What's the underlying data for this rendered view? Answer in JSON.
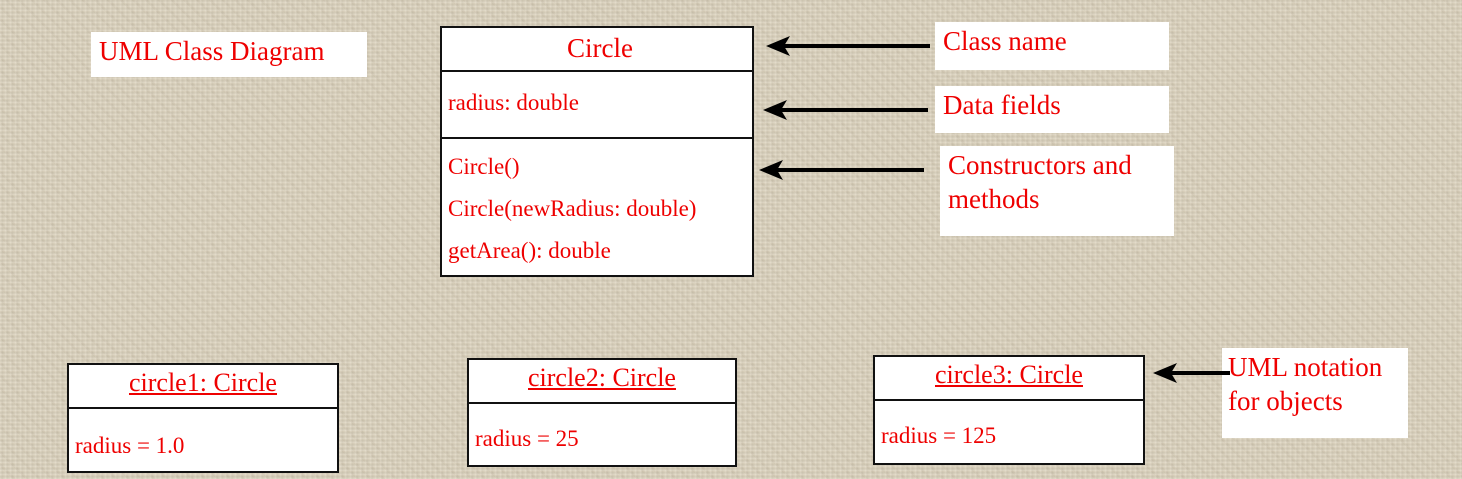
{
  "diagram_title": "UML Class Diagram",
  "class_box": {
    "name": "Circle",
    "fields": [
      "radius: double"
    ],
    "methods": [
      "Circle()",
      "Circle(newRadius: double)",
      "getArea(): double"
    ]
  },
  "callouts": {
    "class_name": "Class name",
    "data_fields": "Data fields",
    "constructors_line1": "Constructors and",
    "constructors_line2": "methods",
    "objects_line1": "UML notation",
    "objects_line2": "for objects"
  },
  "objects": [
    {
      "name": "circle1: Circle",
      "attr": "radius = 1.0"
    },
    {
      "name": "circle2: Circle",
      "attr": "radius = 25"
    },
    {
      "name": "circle3: Circle",
      "attr": "radius = 125"
    }
  ],
  "colors": {
    "text": "#ee0000",
    "border": "#111111",
    "background": "#ddd4bf"
  }
}
